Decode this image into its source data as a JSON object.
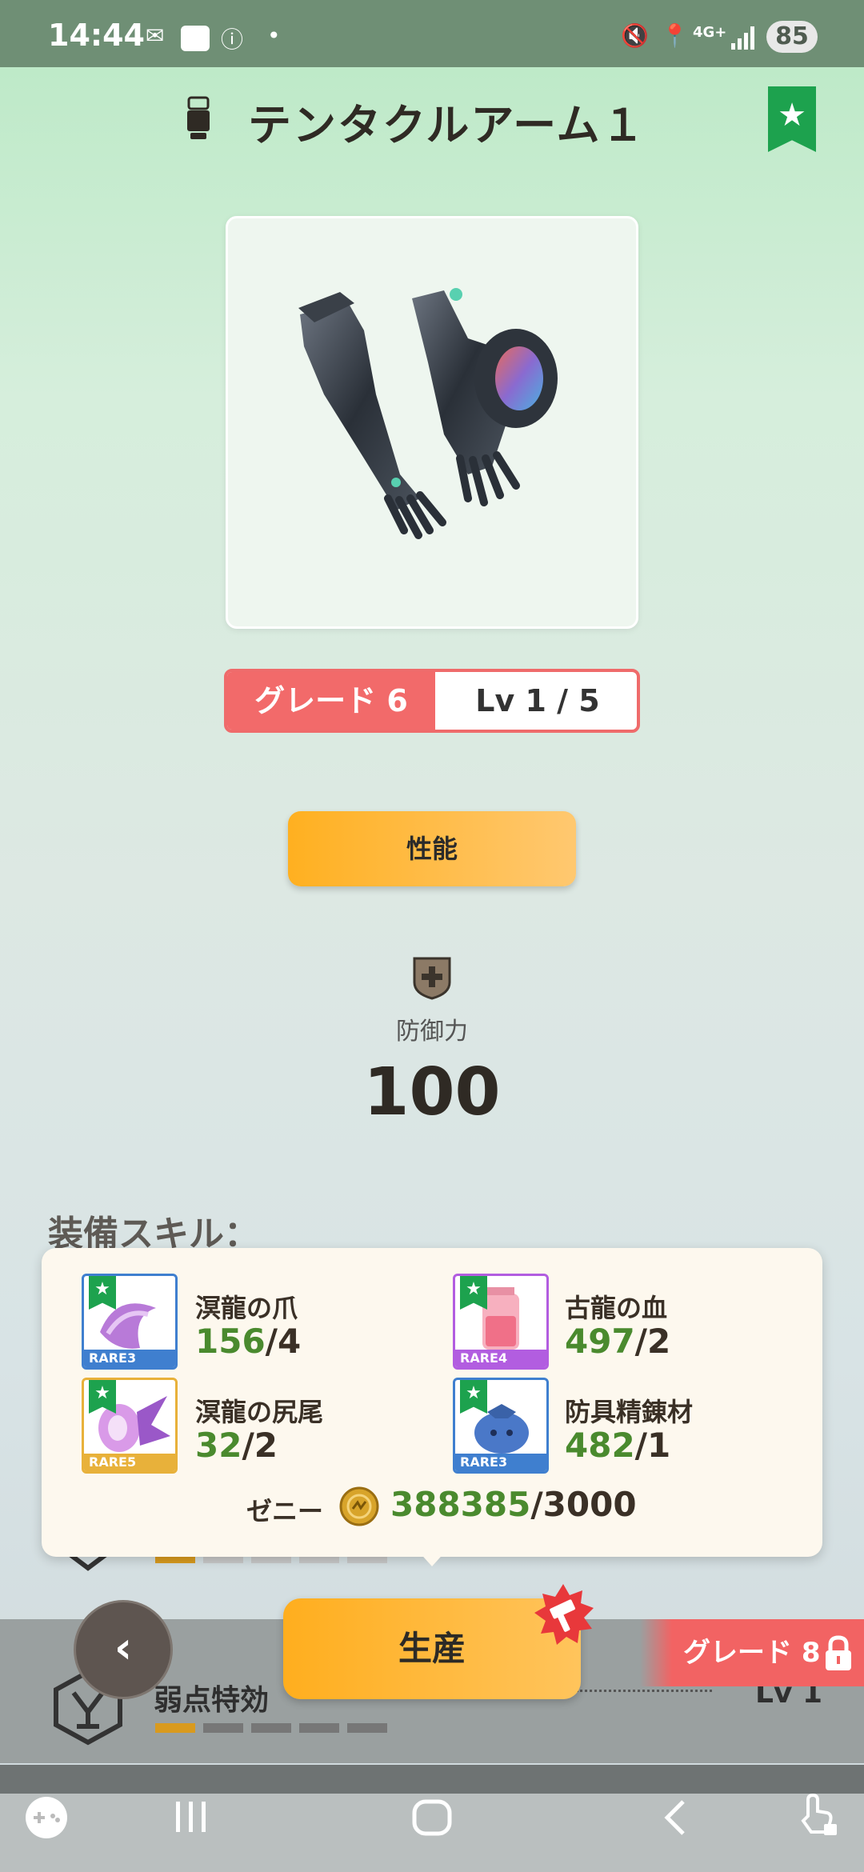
{
  "status_bar": {
    "time": "14:44",
    "network": "4G+",
    "battery": "85"
  },
  "header": {
    "title": "テンタクルアーム１",
    "icon": "gauntlet-icon",
    "favorite_icon": "star-bookmark-icon"
  },
  "equipment": {
    "image": "tentacle-arm-gauntlets",
    "grade": "グレード 6",
    "level": "Lv 1 / 5"
  },
  "performance_button": "性能",
  "defense": {
    "label": "防御力",
    "value": "100"
  },
  "skills_heading": "装備スキル：",
  "materials": [
    {
      "name": "溟龍の爪",
      "have": "156",
      "need": "/4",
      "rarity": "RARE3",
      "rarity_color": "#3f7fcf",
      "icon": "purple-claw-icon"
    },
    {
      "name": "古龍の血",
      "have": "497",
      "need": "/2",
      "rarity": "RARE4",
      "rarity_color": "#b25de0",
      "icon": "blood-jar-icon"
    },
    {
      "name": "溟龍の尻尾",
      "have": "32",
      "need": "/2",
      "rarity": "RARE5",
      "rarity_color": "#e8b13a",
      "icon": "purple-tail-icon"
    },
    {
      "name": "防具精錬材",
      "have": "482",
      "need": "/1",
      "rarity": "RARE3",
      "rarity_color": "#3f7fcf",
      "icon": "blue-pouch-icon"
    }
  ],
  "zenny": {
    "label": "ゼニー",
    "have": "388385",
    "need": "/3000"
  },
  "skill_row": {
    "name": "弱点特効",
    "level": "Lv 1",
    "level_progress": 1,
    "level_max": 5
  },
  "actions": {
    "back": "‹",
    "produce": "生産",
    "locked_grade": "グレード 8"
  },
  "colors": {
    "accent_orange": "#ffb020",
    "grade_red": "#f26a6a",
    "have_green": "#4a8a2e",
    "favorite_green": "#1da24e"
  }
}
